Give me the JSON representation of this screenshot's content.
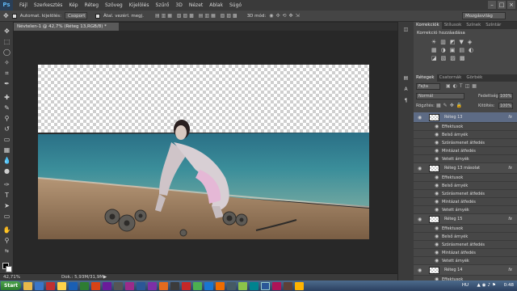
{
  "app": {
    "logo": "Ps"
  },
  "menu": [
    "Fájl",
    "Szerkesztés",
    "Kép",
    "Réteg",
    "Szöveg",
    "Kijelölés",
    "Szűrő",
    "3D",
    "Nézet",
    "Ablak",
    "Súgó"
  ],
  "options": {
    "auto_select_label": "Automat. kijelölés:",
    "auto_select_value": "Csoport",
    "transform_label": "Átal. vezérl. megj.",
    "mode_3d_label": "3D mód:",
    "workspace": "Mozgásvilág"
  },
  "document": {
    "tab_title": "Névtelen-1 @ 42,7% (Réteg 13,RGB/8) *"
  },
  "status": {
    "zoom": "42,71%",
    "doc_info": "Dok.: 5,93M/31,9M"
  },
  "panels": {
    "top_tabs": [
      "Korrekciók",
      "Stílusok",
      "Színek",
      "Színtár"
    ],
    "adjust_title": "Korrekció hozzáadása",
    "layer_tabs": [
      "Rétegek",
      "Csatornák",
      "Görbék"
    ],
    "filter_label": "Fajta",
    "blend_mode": "Normál",
    "opacity_label": "Fedettség:",
    "opacity_value": "100%",
    "lock_label": "Rögzítés:",
    "fill_label": "Kitöltés:",
    "fill_value": "100%"
  },
  "layers": [
    {
      "name": "Réteg 13",
      "selected": true
    },
    {
      "name": "Effektusok",
      "sub": true
    },
    {
      "name": "Belső árnyék",
      "sub": true
    },
    {
      "name": "Szórásmenet átfedés",
      "sub": true
    },
    {
      "name": "Mintázat átfedés",
      "sub": true
    },
    {
      "name": "Vetett árnyék",
      "sub": true
    },
    {
      "name": "Réteg 13 másolat",
      "selected": false
    },
    {
      "name": "Effektusok",
      "sub": true
    },
    {
      "name": "Belső árnyék",
      "sub": true
    },
    {
      "name": "Szórásmenet átfedés",
      "sub": true
    },
    {
      "name": "Mintázat átfedés",
      "sub": true
    },
    {
      "name": "Vetett árnyék",
      "sub": true
    },
    {
      "name": "Réteg 15",
      "selected": false
    },
    {
      "name": "Effektusok",
      "sub": true
    },
    {
      "name": "Belső árnyék",
      "sub": true
    },
    {
      "name": "Szórásmenet átfedés",
      "sub": true
    },
    {
      "name": "Mintázat átfedés",
      "sub": true
    },
    {
      "name": "Vetett árnyék",
      "sub": true
    },
    {
      "name": "Réteg 14",
      "selected": false
    },
    {
      "name": "Effektusok",
      "sub": true
    },
    {
      "name": "Belső árnyék",
      "sub": true
    }
  ],
  "taskbar": {
    "start": "Start",
    "lang": "HU",
    "time": "0:48"
  },
  "colors": {
    "accent": "#2a3f57",
    "selected_layer": "#5d6b85"
  }
}
